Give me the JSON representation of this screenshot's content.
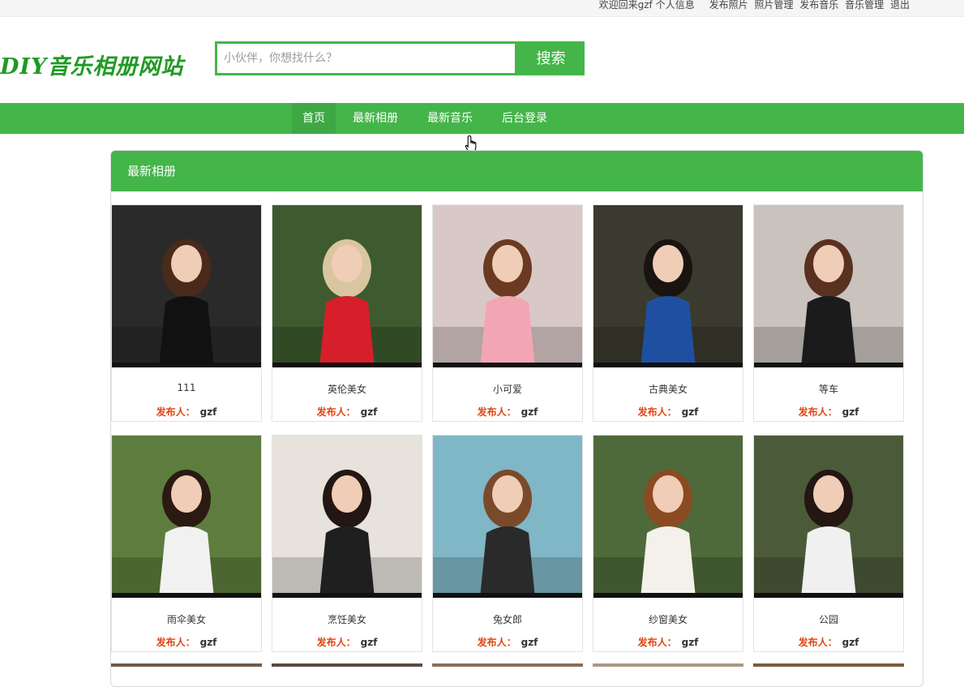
{
  "topbar": {
    "welcome": "欢迎回来gzf",
    "profile": "个人信息",
    "post_photo": "发布照片",
    "manage_photo": "照片管理",
    "post_music": "发布音乐",
    "manage_music": "音乐管理",
    "logout": "退出"
  },
  "logo": {
    "text": "DIY音乐相册网站"
  },
  "search": {
    "placeholder": "小伙伴，你想找什么？",
    "button": "搜索"
  },
  "nav": [
    "首页",
    "最新相册",
    "最新音乐",
    "后台登录"
  ],
  "panel": {
    "title": "最新相册"
  },
  "publisher_label": "发布人：",
  "cards": [
    {
      "title": "111",
      "user": "gzf",
      "bg": "#2a2a2a",
      "hair": "#4a2a1a",
      "dress": "#111111"
    },
    {
      "title": "英伦美女",
      "user": "gzf",
      "bg": "#3e5a2f",
      "hair": "#d8c6a0",
      "dress": "#d61f2a"
    },
    {
      "title": "小可爱",
      "user": "gzf",
      "bg": "#d9c9c6",
      "hair": "#6b3a22",
      "dress": "#f2a6b4"
    },
    {
      "title": "古典美女",
      "user": "gzf",
      "bg": "#3b3a2e",
      "hair": "#1a1410",
      "dress": "#1f4fa0"
    },
    {
      "title": "等车",
      "user": "gzf",
      "bg": "#c9c2bd",
      "hair": "#5a3020",
      "dress": "#1b1b1b"
    },
    {
      "title": "雨伞美女",
      "user": "gzf",
      "bg": "#5d7d3e",
      "hair": "#2a1a12",
      "dress": "#f1f1f1"
    },
    {
      "title": "烹饪美女",
      "user": "gzf",
      "bg": "#e7e2dc",
      "hair": "#241612",
      "dress": "#1f1f1f"
    },
    {
      "title": "兔女郎",
      "user": "gzf",
      "bg": "#7fb7c6",
      "hair": "#7a4a2a",
      "dress": "#2a2a2a"
    },
    {
      "title": "纱窗美女",
      "user": "gzf",
      "bg": "#4f6a3a",
      "hair": "#8a4a22",
      "dress": "#f4f1ea"
    },
    {
      "title": "公园",
      "user": "gzf",
      "bg": "#4b5b3a",
      "hair": "#241612",
      "dress": "#f0f0f0"
    }
  ],
  "colors": {
    "accent": "#44b549",
    "label_red": "#e1440f"
  }
}
